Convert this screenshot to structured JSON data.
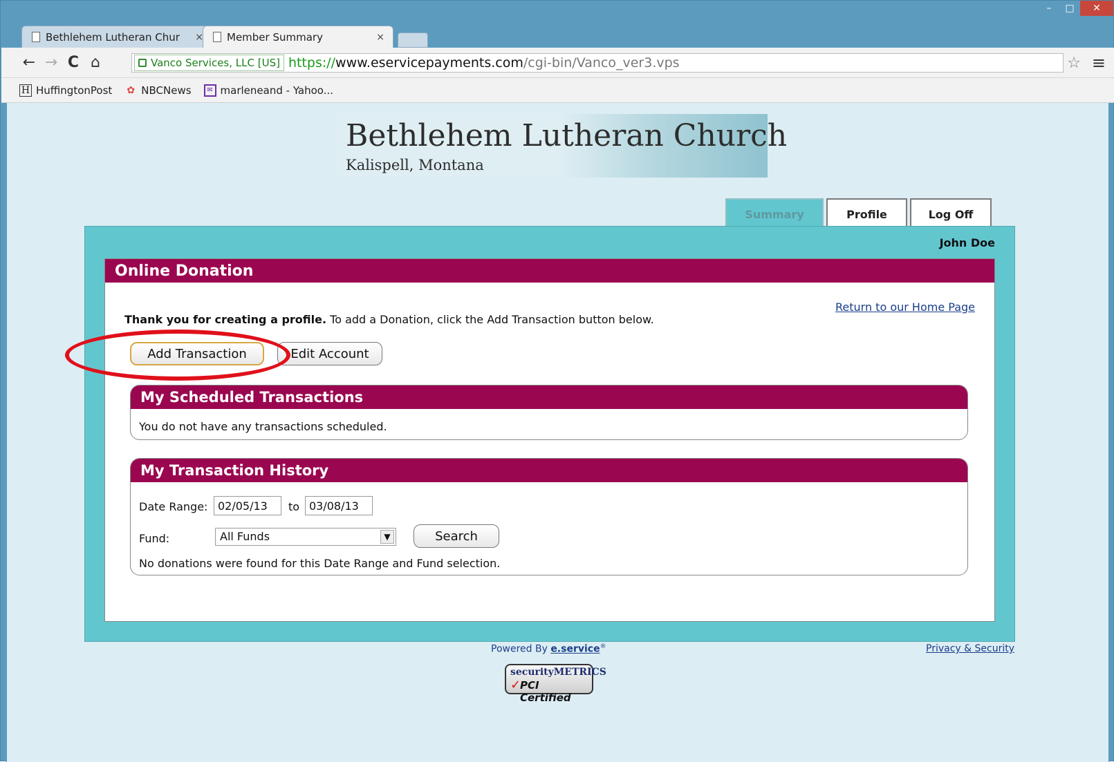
{
  "browser": {
    "tabs": [
      {
        "label": "Bethlehem Lutheran Chur",
        "close": "×"
      },
      {
        "label": "Member Summary",
        "close": "×"
      }
    ],
    "window_controls": {
      "minimize": "–",
      "maximize": "□",
      "close": "✕"
    },
    "nav": {
      "back": "←",
      "forward": "→",
      "reload": "C",
      "home": "⌂"
    },
    "ev_label": "Vanco Services, LLC [US]",
    "url": {
      "scheme": "https://",
      "host": "www.eservicepayments.com",
      "path": "/cgi-bin/Vanco_ver3.vps"
    },
    "star": "☆",
    "menu": "≡",
    "bookmarks": [
      {
        "icon": "H",
        "label": "HuffingtonPost"
      },
      {
        "icon": "✿",
        "label": "NBCNews"
      },
      {
        "icon": "✉",
        "label": "marleneand - Yahoo..."
      }
    ]
  },
  "site": {
    "name": "Bethlehem Lutheran Church",
    "city": "Kalispell, Montana"
  },
  "tabs": {
    "summary": "Summary",
    "profile": "Profile",
    "logoff": "Log Off"
  },
  "user": "John Doe",
  "panel": {
    "title": "Online Donation",
    "home_link": "Return to our Home Page",
    "thanks_bold": "Thank you for creating a profile.",
    "thanks_rest": " To add a Donation, click the Add Transaction button below.",
    "add_button": "Add Transaction",
    "edit_button": "Edit Account"
  },
  "scheduled": {
    "title": "My Scheduled Transactions",
    "message": "You do not have any transactions scheduled."
  },
  "history": {
    "title": "My Transaction History",
    "date_range_label": "Date Range:",
    "from": "02/05/13",
    "to_label": "to",
    "to": "03/08/13",
    "fund_label": "Fund:",
    "fund_value": "All Funds",
    "search_button": "Search",
    "message": "No donations were found for this Date Range and Fund selection."
  },
  "footer": {
    "powered_prefix": "Powered By ",
    "powered_link": "e.service",
    "powered_mark": "®",
    "privacy": "Privacy & Security",
    "badge_top": "securityMETRICS",
    "badge_bottom": "PCI Certified",
    "badge_check": "✓"
  },
  "annotation_color": "#e0101a"
}
